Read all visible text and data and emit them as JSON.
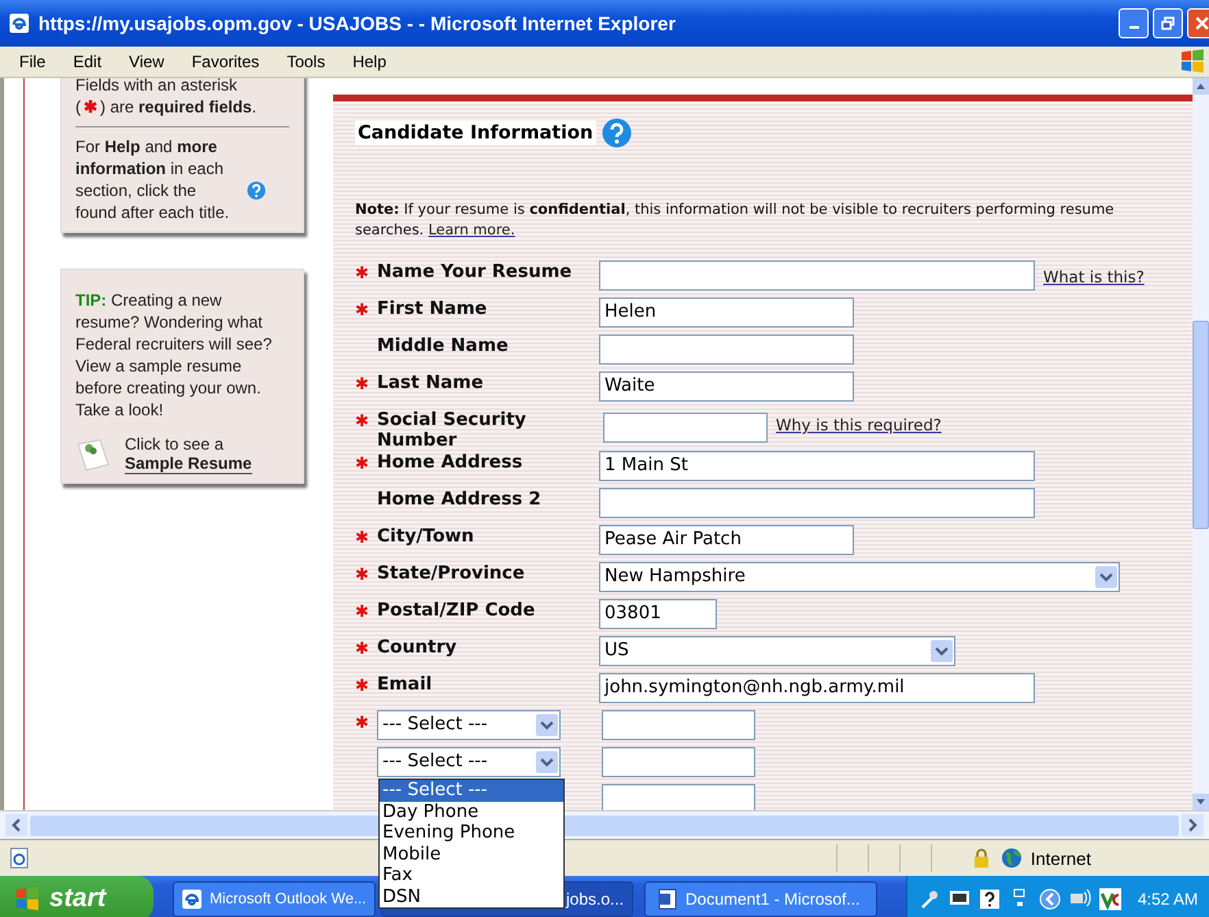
{
  "window": {
    "title": "https://my.usajobs.opm.gov - USAJOBS - - Microsoft Internet Explorer"
  },
  "menu": [
    "File",
    "Edit",
    "View",
    "Favorites",
    "Tools",
    "Help"
  ],
  "sidebar": {
    "required_intro": "Fields with an asterisk",
    "required_open": "(",
    "required_mark": "✱",
    "required_close": ") are **required fields**.",
    "help_before": "For **Help** and **more information** in each section, click the",
    "help_after": "found after each title.",
    "tip": "**TIP:** Creating a new resume? Wondering what Federal recruiters will see? View a sample resume before creating your own. Take a look!",
    "sample_line1": "Click to see a",
    "sample_line2": "Sample Resume"
  },
  "form": {
    "title": "Candidate Information",
    "required_mark": "✱",
    "note": "**Note:** If your resume is **confidential**, this information will not be visible to recruiters performing resume searches.",
    "note_link": "Learn more.",
    "rows": [
      {
        "kind": "text",
        "label": "Name Your Resume",
        "required": true,
        "link": "What is this?"
      },
      {
        "kind": "text",
        "label": "First Name",
        "required": true,
        "value": "Helen"
      },
      {
        "kind": "text",
        "label": "Middle Name",
        "required": false
      },
      {
        "kind": "text",
        "label": "Last Name",
        "required": true,
        "value": "Waite"
      },
      {
        "kind": "text",
        "label": "Social Security Number",
        "required": true,
        "link": "Why is this required?"
      },
      {
        "kind": "text",
        "label": "Home Address",
        "required": true,
        "value": "1 Main St"
      },
      {
        "kind": "text",
        "label": "Home Address 2",
        "required": false
      },
      {
        "kind": "text",
        "label": "City/Town",
        "required": true,
        "value": "Pease Air Patch"
      },
      {
        "kind": "select",
        "label": "State/Province",
        "required": true,
        "value": "New Hampshire"
      },
      {
        "kind": "text",
        "label": "Postal/ZIP Code",
        "required": true,
        "value": "03801"
      },
      {
        "kind": "select",
        "label": "Country",
        "required": true,
        "value": "US"
      },
      {
        "kind": "text",
        "label": "Email",
        "required": true,
        "value": "john.symington@nh.ngb.army.mil"
      },
      {
        "kind": "phone",
        "required": true,
        "value": "--- Select ---"
      },
      {
        "kind": "phone",
        "required": false,
        "value": "--- Select ---",
        "open": true
      },
      {
        "kind": "phone_field",
        "required": false
      }
    ],
    "dropdown": [
      {
        "label": "--- Select ---",
        "selected": true
      },
      {
        "label": "Day Phone",
        "selected": false
      },
      {
        "label": "Evening Phone",
        "selected": false
      },
      {
        "label": "Mobile",
        "selected": false
      },
      {
        "label": "Fax",
        "selected": false
      },
      {
        "label": "DSN",
        "selected": false
      }
    ]
  },
  "status_bar": {
    "zone": "Internet"
  },
  "taskbar": {
    "start": "start",
    "tasks": [
      {
        "label": "Microsoft Outlook We...",
        "kind": "ie"
      },
      {
        "label": "jobs.o...",
        "kind": "plain"
      },
      {
        "label": "Document1 - Microsof...",
        "kind": "word"
      }
    ],
    "clock": "4:52 AM"
  }
}
